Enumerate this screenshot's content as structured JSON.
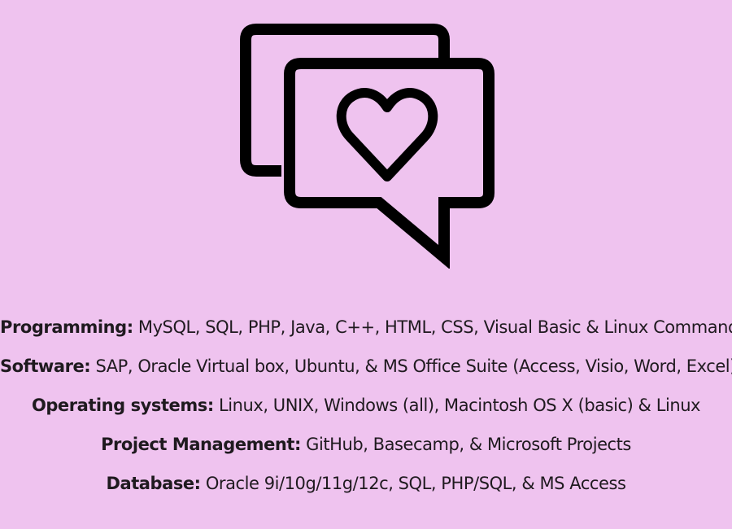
{
  "theme": {
    "background": "#efc3ef",
    "text": "#1f1a1f",
    "icon": "#000000"
  },
  "hero": {
    "icon": "speech-bubbles-heart-icon"
  },
  "skills": [
    {
      "label": "Programming:",
      "value": " MySQL, SQL, PHP, Java, C++, HTML, CSS, Visual Basic & Linux Commands"
    },
    {
      "label": "Software:",
      "value": " SAP, Oracle Virtual box, Ubuntu, & MS Office Suite (Access, Visio, Word, Excel)"
    },
    {
      "label": "Operating systems:",
      "value": " Linux, UNIX, Windows (all), Macintosh OS X (basic) & Linux"
    },
    {
      "label": "Project Management:",
      "value": " GitHub, Basecamp, & Microsoft Projects"
    },
    {
      "label": "Database:",
      "value": " Oracle 9i/10g/11g/12c, SQL, PHP/SQL, & MS Access"
    }
  ]
}
